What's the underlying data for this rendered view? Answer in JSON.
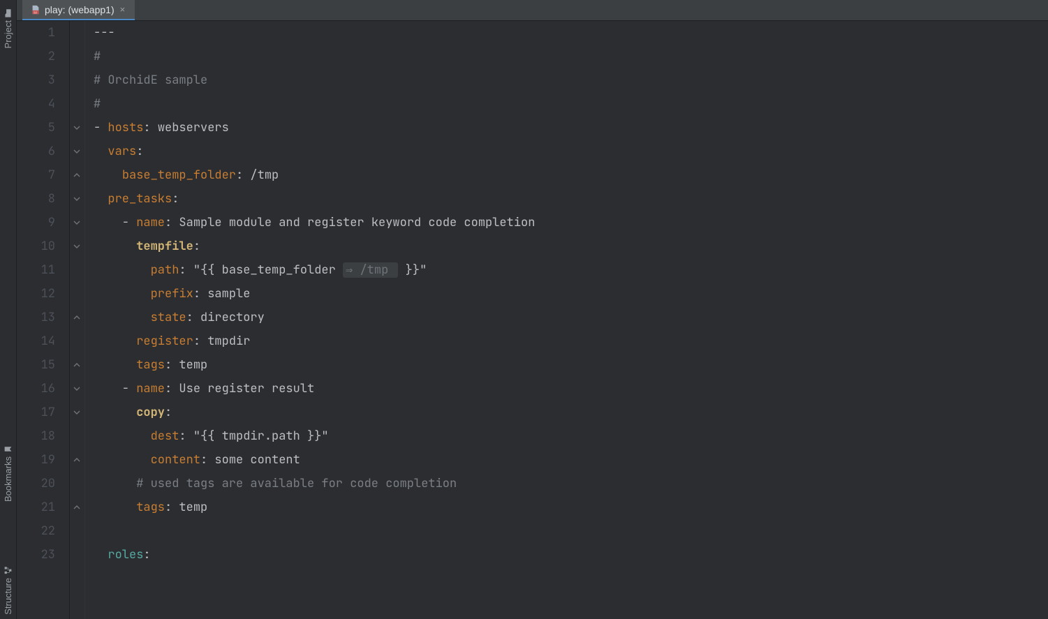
{
  "toolwindows": {
    "project": "Project",
    "bookmarks": "Bookmarks",
    "structure": "Structure"
  },
  "tab": {
    "label": "play: (webapp1)"
  },
  "lines": [
    {
      "n": 1,
      "fold": "",
      "raw": [
        [
          "plain",
          "---"
        ]
      ]
    },
    {
      "n": 2,
      "fold": "",
      "raw": [
        [
          "comment",
          "#"
        ]
      ]
    },
    {
      "n": 3,
      "fold": "",
      "raw": [
        [
          "comment",
          "# OrchidE sample"
        ]
      ]
    },
    {
      "n": 4,
      "fold": "",
      "raw": [
        [
          "comment",
          "#"
        ]
      ]
    },
    {
      "n": 5,
      "fold": "open",
      "raw": [
        [
          "plain",
          "- "
        ],
        [
          "key",
          "hosts"
        ],
        [
          "plain",
          ": "
        ],
        [
          "plain",
          "webservers"
        ]
      ]
    },
    {
      "n": 6,
      "fold": "open",
      "raw": [
        [
          "plain",
          "  "
        ],
        [
          "key",
          "vars"
        ],
        [
          "plain",
          ":"
        ]
      ]
    },
    {
      "n": 7,
      "fold": "end",
      "raw": [
        [
          "plain",
          "    "
        ],
        [
          "key",
          "base_temp_folder"
        ],
        [
          "plain",
          ": "
        ],
        [
          "plain",
          "/tmp"
        ]
      ]
    },
    {
      "n": 8,
      "fold": "open",
      "raw": [
        [
          "plain",
          "  "
        ],
        [
          "key",
          "pre_tasks"
        ],
        [
          "plain",
          ":"
        ]
      ]
    },
    {
      "n": 9,
      "fold": "open",
      "raw": [
        [
          "plain",
          "    - "
        ],
        [
          "key",
          "name"
        ],
        [
          "plain",
          ": "
        ],
        [
          "plain",
          "Sample module and register keyword code completion"
        ]
      ]
    },
    {
      "n": 10,
      "fold": "open",
      "raw": [
        [
          "plain",
          "      "
        ],
        [
          "keyb",
          "tempfile"
        ],
        [
          "plain",
          ":"
        ]
      ]
    },
    {
      "n": 11,
      "fold": "",
      "raw": [
        [
          "plain",
          "        "
        ],
        [
          "key",
          "path"
        ],
        [
          "plain",
          ": "
        ],
        [
          "str",
          "\"{{ base_temp_folder "
        ],
        [
          "ghost",
          "⇒ /tmp "
        ],
        [
          "str",
          " }}\""
        ]
      ]
    },
    {
      "n": 12,
      "fold": "",
      "raw": [
        [
          "plain",
          "        "
        ],
        [
          "key",
          "prefix"
        ],
        [
          "plain",
          ": "
        ],
        [
          "plain",
          "sample"
        ]
      ]
    },
    {
      "n": 13,
      "fold": "end",
      "raw": [
        [
          "plain",
          "        "
        ],
        [
          "key",
          "state"
        ],
        [
          "plain",
          ": "
        ],
        [
          "plain",
          "directory"
        ]
      ]
    },
    {
      "n": 14,
      "fold": "",
      "raw": [
        [
          "plain",
          "      "
        ],
        [
          "key",
          "register"
        ],
        [
          "plain",
          ": "
        ],
        [
          "plain",
          "tmpdir"
        ]
      ]
    },
    {
      "n": 15,
      "fold": "end",
      "raw": [
        [
          "plain",
          "      "
        ],
        [
          "key",
          "tags"
        ],
        [
          "plain",
          ": "
        ],
        [
          "plain",
          "temp"
        ]
      ]
    },
    {
      "n": 16,
      "fold": "open",
      "raw": [
        [
          "plain",
          "    - "
        ],
        [
          "key",
          "name"
        ],
        [
          "plain",
          ": "
        ],
        [
          "plain",
          "Use register result"
        ]
      ]
    },
    {
      "n": 17,
      "fold": "open",
      "raw": [
        [
          "plain",
          "      "
        ],
        [
          "keyb",
          "copy"
        ],
        [
          "plain",
          ":"
        ]
      ]
    },
    {
      "n": 18,
      "fold": "",
      "raw": [
        [
          "plain",
          "        "
        ],
        [
          "key",
          "dest"
        ],
        [
          "plain",
          ": "
        ],
        [
          "str",
          "\"{{ tmpdir.path }}\""
        ]
      ]
    },
    {
      "n": 19,
      "fold": "end",
      "raw": [
        [
          "plain",
          "        "
        ],
        [
          "key",
          "content"
        ],
        [
          "plain",
          ": "
        ],
        [
          "plain",
          "some content"
        ]
      ]
    },
    {
      "n": 20,
      "fold": "",
      "raw": [
        [
          "plain",
          "      "
        ],
        [
          "comment",
          "# used tags are available for code completion"
        ]
      ]
    },
    {
      "n": 21,
      "fold": "end",
      "raw": [
        [
          "plain",
          "      "
        ],
        [
          "key",
          "tags"
        ],
        [
          "plain",
          ": "
        ],
        [
          "plain",
          "temp"
        ]
      ]
    },
    {
      "n": 22,
      "fold": "",
      "raw": []
    },
    {
      "n": 23,
      "fold": "",
      "raw": [
        [
          "plain",
          "  "
        ],
        [
          "teal",
          "roles"
        ],
        [
          "plain",
          ":"
        ]
      ]
    }
  ]
}
